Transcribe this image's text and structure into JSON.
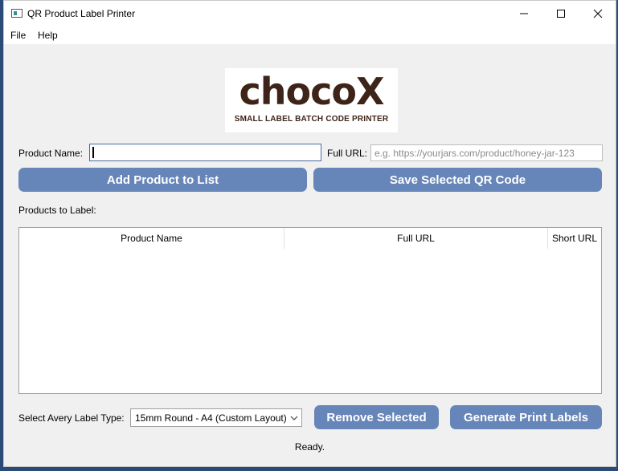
{
  "window": {
    "title": "QR Product Label Printer"
  },
  "menu": {
    "file": "File",
    "help": "Help"
  },
  "logo": {
    "brand": "chocoX",
    "tagline": "SMALL LABEL BATCH CODE PRINTER"
  },
  "form": {
    "product_name_label": "Product Name:",
    "product_name_value": "",
    "full_url_label": "Full URL:",
    "full_url_placeholder": "e.g. https://yourjars.com/product/honey-jar-123"
  },
  "buttons": {
    "add": "Add Product to List",
    "save_qr": "Save Selected QR Code",
    "remove": "Remove Selected",
    "generate": "Generate  Print Labels"
  },
  "products": {
    "section_label": "Products to Label:",
    "columns": [
      "Product Name",
      "Full URL",
      "Short URL"
    ],
    "rows": []
  },
  "label_type": {
    "label": "Select Avery Label Type:",
    "selected": "15mm Round - A4 (Custom Layout)"
  },
  "status": "Ready.",
  "colors": {
    "button": "#6685b8",
    "logo_text": "#3e2418"
  }
}
